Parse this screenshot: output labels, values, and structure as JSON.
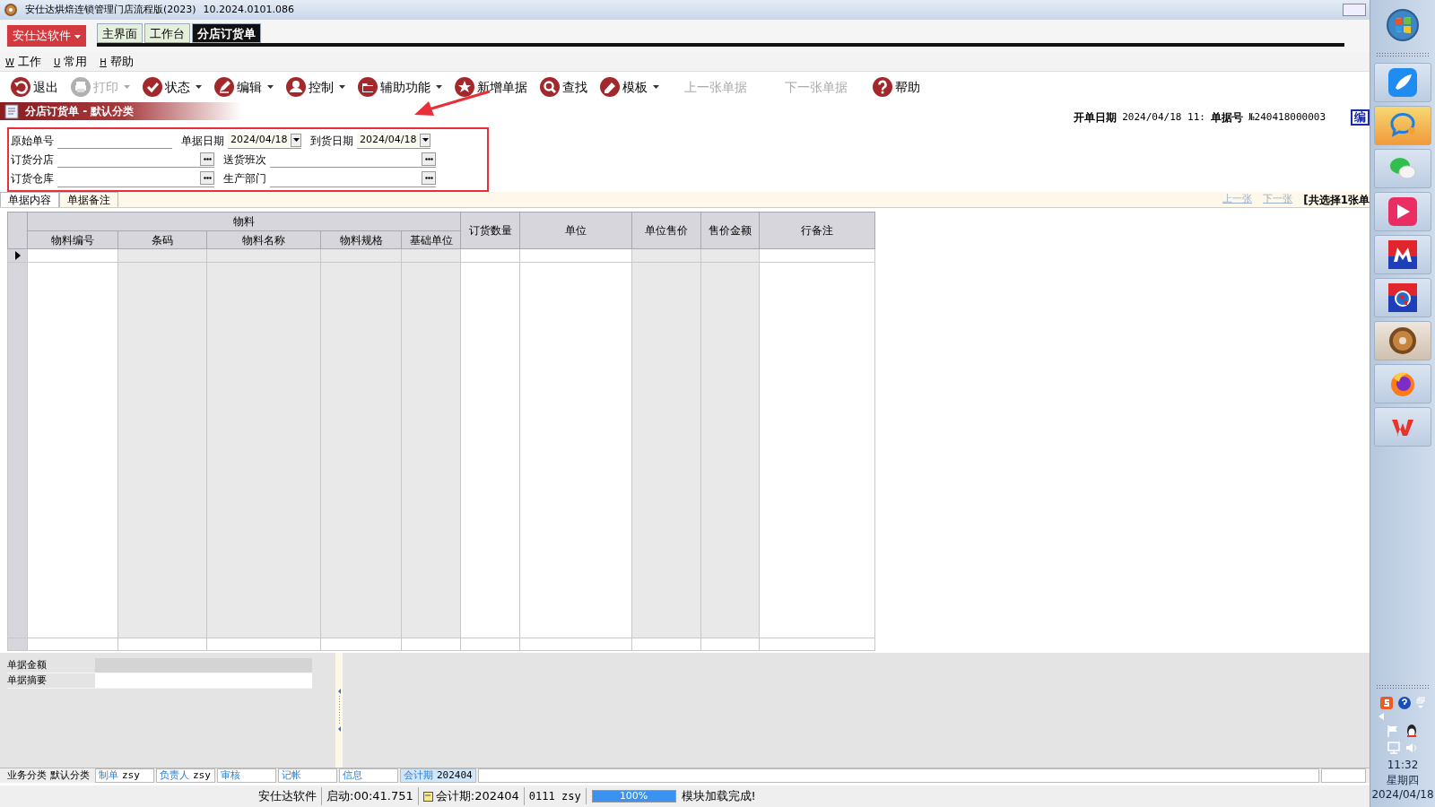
{
  "window": {
    "title": "安仕达烘焙连锁管理门店流程版(2023)",
    "version": "10.2024.0101.086"
  },
  "app_button": {
    "label": "安仕达软件"
  },
  "tabs": [
    {
      "label": "主界面",
      "selected": false
    },
    {
      "label": "工作台",
      "selected": false
    },
    {
      "label": "分店订货单",
      "selected": true
    }
  ],
  "menu": [
    {
      "shortcut": "W",
      "label": "工作"
    },
    {
      "shortcut": "U",
      "label": "常用"
    },
    {
      "shortcut": "H",
      "label": "帮助"
    }
  ],
  "toolbar": [
    {
      "kind": "icon",
      "label": "退出",
      "disabled": false,
      "dropdown": false
    },
    {
      "kind": "icon",
      "label": "打印",
      "disabled": true,
      "dropdown": true
    },
    {
      "kind": "icon",
      "label": "状态",
      "disabled": false,
      "dropdown": true
    },
    {
      "kind": "icon",
      "label": "编辑",
      "disabled": false,
      "dropdown": true
    },
    {
      "kind": "icon",
      "label": "控制",
      "disabled": false,
      "dropdown": true
    },
    {
      "kind": "icon",
      "label": "辅助功能",
      "disabled": false,
      "dropdown": true
    },
    {
      "kind": "icon",
      "label": "新增单据",
      "disabled": false,
      "dropdown": false
    },
    {
      "kind": "icon",
      "label": "查找",
      "disabled": false,
      "dropdown": false
    },
    {
      "kind": "icon",
      "label": "模板",
      "disabled": false,
      "dropdown": true
    },
    {
      "kind": "text",
      "label": "上一张单据",
      "disabled": true,
      "dropdown": false
    },
    {
      "kind": "text",
      "label": "下一张单据",
      "disabled": true,
      "dropdown": false
    },
    {
      "kind": "icon",
      "label": "帮助",
      "disabled": false,
      "dropdown": false
    }
  ],
  "document": {
    "title": "分店订货单 - 默认分类",
    "info": [
      {
        "label": "开单日期",
        "value": "2024/04/18 11:"
      },
      {
        "label": "单据号",
        "value": "№240418000003"
      }
    ],
    "number_button": "编"
  },
  "form": {
    "rows": [
      [
        {
          "label": "原始单号",
          "kind": "text"
        },
        {
          "label": "单据日期",
          "kind": "date",
          "value": "2024/04/18"
        },
        {
          "label": "到货日期",
          "kind": "date",
          "value": "2024/04/18"
        }
      ],
      [
        {
          "label": "订货分店",
          "kind": "lookup"
        },
        {
          "label": "送货班次",
          "kind": "lookup"
        }
      ],
      [
        {
          "label": "订货仓库",
          "kind": "lookup"
        },
        {
          "label": "生产部门",
          "kind": "lookup"
        }
      ]
    ]
  },
  "doc_tabs": [
    {
      "label": "单据内容",
      "selected": true
    },
    {
      "label": "单据备注",
      "selected": false
    }
  ],
  "pager": {
    "links": [
      {
        "label": "上一张",
        "disabled": true
      },
      {
        "label": "下一张",
        "disabled": true
      }
    ],
    "summary": "[共选择1张单"
  },
  "grid": {
    "columns": [
      {
        "label": "物料",
        "children": [
          {
            "label": "物料编号",
            "readonly": false
          },
          {
            "label": "条码",
            "readonly": true
          },
          {
            "label": "物料名称",
            "readonly": true
          },
          {
            "label": "物料规格",
            "readonly": true
          },
          {
            "label": "基础单位",
            "readonly": true
          }
        ]
      },
      {
        "label": "订货数量",
        "readonly": false
      },
      {
        "label": "单位",
        "readonly": false
      },
      {
        "label": "单位售价",
        "readonly": true
      },
      {
        "label": "售价金额",
        "readonly": true
      },
      {
        "label": "行备注",
        "readonly": false
      }
    ],
    "rows": [
      {
        "current": true
      }
    ]
  },
  "summary": [
    {
      "label": "单据金额",
      "readonly": true
    },
    {
      "label": "单据摘要",
      "readonly": false
    }
  ],
  "status_bar": [
    {
      "kind": "plain",
      "label": "业务分类",
      "value": "默认分类"
    },
    {
      "kind": "link",
      "label": "制单",
      "value": "zsy"
    },
    {
      "kind": "link",
      "label": "负责人",
      "value": "zsy"
    },
    {
      "kind": "link",
      "label": "审核"
    },
    {
      "kind": "link",
      "label": "记帐"
    },
    {
      "kind": "link",
      "label": "信息"
    },
    {
      "kind": "highlight",
      "label": "会计期",
      "value": "202404"
    }
  ],
  "footer": {
    "company": "安仕达软件",
    "uptime": "启动:00:41.751",
    "period": "会计期:202404",
    "user": "0111 zsy",
    "progress": {
      "level": 1,
      "reading": "100%"
    },
    "message": "模块加载完成!"
  },
  "taskbar": {
    "apps": [
      {
        "highlighted": false,
        "selected": false
      },
      {
        "highlighted": true,
        "selected": false
      },
      {
        "highlighted": false,
        "selected": false
      },
      {
        "highlighted": false,
        "selected": false
      },
      {
        "highlighted": false,
        "selected": false
      },
      {
        "highlighted": false,
        "selected": false
      },
      {
        "highlighted": false,
        "selected": true
      },
      {
        "highlighted": false,
        "selected": false
      },
      {
        "highlighted": false,
        "selected": false
      }
    ],
    "tray": {
      "time": "11:32",
      "weekday": "星期四",
      "date": "2024/04/18"
    }
  }
}
